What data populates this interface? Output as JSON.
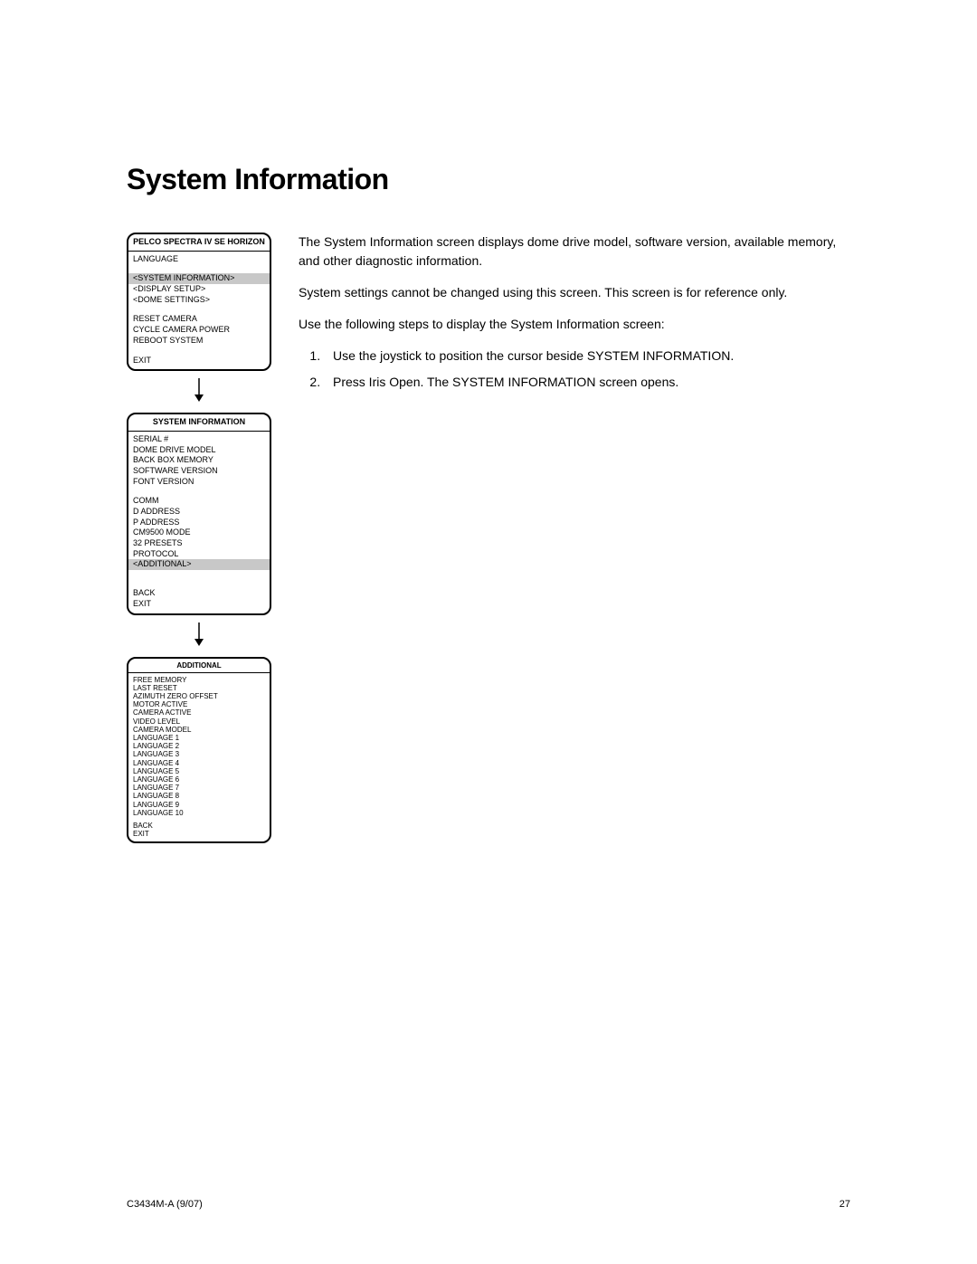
{
  "heading": "System Information",
  "menu1": {
    "title": "PELCO SPECTRA IV SE HORIZON",
    "items1": [
      "LANGUAGE"
    ],
    "highlight": "<SYSTEM INFORMATION>",
    "items2": [
      "<DISPLAY SETUP>",
      "<DOME SETTINGS>"
    ],
    "items3": [
      "RESET CAMERA",
      "CYCLE CAMERA POWER",
      "REBOOT SYSTEM"
    ],
    "items4": [
      "EXIT"
    ]
  },
  "menu2": {
    "title": "SYSTEM INFORMATION",
    "items1": [
      "SERIAL #",
      "DOME DRIVE MODEL",
      "BACK BOX MEMORY",
      "SOFTWARE VERSION",
      "FONT VERSION"
    ],
    "items2": [
      "COMM",
      "D ADDRESS",
      "P ADDRESS",
      "CM9500 MODE",
      "32 PRESETS",
      "PROTOCOL"
    ],
    "highlight": "<ADDITIONAL>",
    "items3": [
      "BACK",
      "EXIT"
    ]
  },
  "menu3": {
    "title": "ADDITIONAL",
    "items1": [
      "FREE MEMORY",
      "LAST RESET",
      "AZIMUTH ZERO OFFSET",
      "MOTOR ACTIVE",
      "CAMERA ACTIVE",
      "VIDEO LEVEL",
      "CAMERA MODEL"
    ],
    "items2": [
      "LANGUAGE 1",
      "LANGUAGE 2",
      "LANGUAGE 3",
      "LANGUAGE 4",
      "LANGUAGE 5",
      "LANGUAGE 6",
      "LANGUAGE 7",
      "LANGUAGE 8",
      "LANGUAGE 9",
      "LANGUAGE 10"
    ],
    "items3": [
      "BACK",
      "EXIT"
    ]
  },
  "body": {
    "p1": "The System Information screen displays dome drive model, software version, available memory, and other diagnostic information.",
    "p2": "System settings cannot be changed using this screen. This screen is for reference only.",
    "p3": "Use the following steps to display the System Information screen:",
    "li1": "Use the joystick to position the cursor beside SYSTEM INFORMATION.",
    "li2": "Press Iris Open. The SYSTEM INFORMATION screen opens."
  },
  "footer": {
    "left": "C3434M-A (9/07)",
    "right": "27"
  }
}
